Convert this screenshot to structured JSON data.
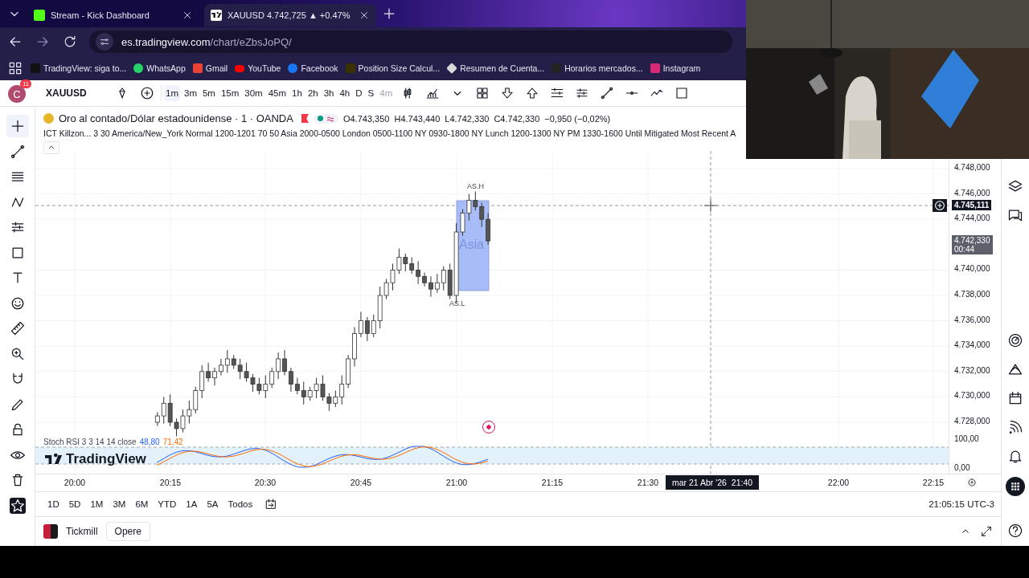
{
  "browser": {
    "tabs": [
      {
        "title": "Stream - Kick Dashboard",
        "selected": false,
        "kind": "kick"
      },
      {
        "title": "XAUUSD 4.742,725 ▲ +0.47%",
        "selected": true,
        "kind": "tradingview"
      }
    ],
    "url": {
      "domain": "es.tradingview.com",
      "path": "/chart/eZbsJoPQ/"
    },
    "bookmarks": [
      {
        "label": "TradingView: siga to...",
        "kind": "tradingview"
      },
      {
        "label": "WhatsApp",
        "kind": "whatsapp"
      },
      {
        "label": "Gmail",
        "kind": "gmail"
      },
      {
        "label": "YouTube",
        "kind": "youtube"
      },
      {
        "label": "Facebook",
        "kind": "facebook"
      },
      {
        "label": "Position Size Calcul...",
        "kind": "fx"
      },
      {
        "label": "Resumen de Cuenta...",
        "kind": "diamond"
      },
      {
        "label": "Horarios mercados...",
        "kind": "inv"
      },
      {
        "label": "Instagram",
        "kind": "instagram"
      }
    ]
  },
  "toolbar": {
    "account": {
      "initial": "C",
      "badge": "11"
    },
    "symbol": "XAUUSD",
    "intervals": [
      {
        "label": "1m",
        "selected": true,
        "disabled": false
      },
      {
        "label": "3m",
        "selected": false,
        "disabled": false
      },
      {
        "label": "5m",
        "selected": false,
        "disabled": false
      },
      {
        "label": "15m",
        "selected": false,
        "disabled": false
      },
      {
        "label": "30m",
        "selected": false,
        "disabled": false
      },
      {
        "label": "45m",
        "selected": false,
        "disabled": false
      },
      {
        "label": "1h",
        "selected": false,
        "disabled": false
      },
      {
        "label": "2h",
        "selected": false,
        "disabled": false
      },
      {
        "label": "3h",
        "selected": false,
        "disabled": false
      },
      {
        "label": "4h",
        "selected": false,
        "disabled": false
      },
      {
        "label": "D",
        "selected": false,
        "disabled": false
      },
      {
        "label": "S",
        "selected": false,
        "disabled": false
      },
      {
        "label": "4m",
        "selected": false,
        "disabled": true
      }
    ]
  },
  "legend": {
    "title": "Oro al contado/Dólar estadounidense · 1 · OANDA",
    "ohlc": [
      "O4.743,350",
      "H4.743,440",
      "L4.742,330",
      "C4.742,330",
      "−0,950 (−0,02%)"
    ],
    "indicator": "ICT Killzon... 3 30 America/New_York Normal 1200-1201 70 50 Asia 2000-0500 London 0500-1100 NY 0930-1800 NY Lunch 1200-1300 NY PM 1330-1600 Until Mitigated Most Recent A"
  },
  "chart": {
    "session": {
      "high": "AS.H",
      "name": "Asia",
      "low": "AS.L"
    },
    "price_ticks": [
      "4.748,000",
      "4.746,000",
      "4.744,000",
      "4.740,000",
      "4.738,000",
      "4.736,000",
      "4.734,000",
      "4.732,000",
      "4.730,000",
      "4.728,000"
    ],
    "crosshair_price": "4.745,111",
    "last_price": "4.742,330",
    "countdown": "00:44",
    "time_ticks": [
      "20:00",
      "20:15",
      "20:30",
      "20:45",
      "21:00",
      "21:15",
      "21:30",
      "22:00",
      "22:15"
    ],
    "crosshair_time": "mar 21 Abr '26  21:40",
    "logo": "TradingView"
  },
  "oscillator": {
    "name": "Stoch RSI 3 3 14 14 close",
    "k": "48,80",
    "d": "71,42",
    "ticks": [
      "100,00",
      "0,00"
    ]
  },
  "ranges": [
    "1D",
    "5D",
    "1M",
    "3M",
    "6M",
    "YTD",
    "1A",
    "5A",
    "Todos"
  ],
  "clock": "21:05:15 UTC-3",
  "broker": {
    "name": "Tickmill",
    "action": "Opere"
  },
  "webcam": {
    "kind": "picture"
  }
}
